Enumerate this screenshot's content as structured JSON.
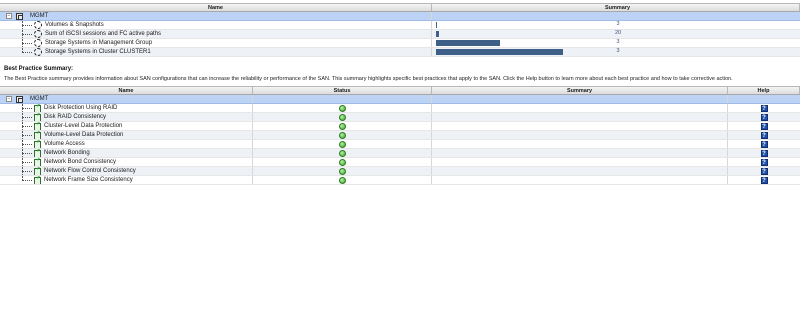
{
  "top_table": {
    "headers": {
      "name": "Name",
      "summary": "Summary"
    },
    "root": {
      "label": "MGMT"
    },
    "rows": [
      {
        "label": "Volumes & Snapshots",
        "value": "3",
        "fill": 0.004
      },
      {
        "label": "Sum of iSCSI sessions and FC active paths",
        "value": "20",
        "fill": 0.012
      },
      {
        "label": "Storage Systems in Management Group",
        "value": "3",
        "fill": 0.28
      },
      {
        "label": "Storage Systems in Cluster CLUSTER1",
        "value": "3",
        "fill": 0.55
      }
    ]
  },
  "best_practice": {
    "title": "Best Practice Summary:",
    "description": "The Best Practice summary provides information about SAN configurations that can increase the reliability or performance of the SAN. This summary highlights specific best practices that apply to the SAN. Click the Help button to learn more about each best practice and how to take corrective action."
  },
  "bp_table": {
    "headers": {
      "name": "Name",
      "status": "Status",
      "summary": "Summary",
      "help": "Help"
    },
    "root": {
      "label": "MGMT"
    },
    "rows": [
      {
        "label": "Disk Protection Using RAID",
        "status": "ok"
      },
      {
        "label": "Disk RAID Consistency",
        "status": "ok"
      },
      {
        "label": "Cluster-Level Data Protection",
        "status": "ok"
      },
      {
        "label": "Volume-Level Data Protection",
        "status": "ok"
      },
      {
        "label": "Volume Access",
        "status": "ok"
      },
      {
        "label": "Network Bonding",
        "status": "ok"
      },
      {
        "label": "Network Bond Consistency",
        "status": "ok"
      },
      {
        "label": "Network Flow Control Consistency",
        "status": "ok"
      },
      {
        "label": "Network Frame Size Consistency",
        "status": "ok"
      }
    ],
    "help_glyph": "?"
  },
  "colors": {
    "selected_row": "#bcd3f5",
    "bar": "#3e5f87",
    "ok": "#3aa52c",
    "help": "#1f4fa8"
  }
}
